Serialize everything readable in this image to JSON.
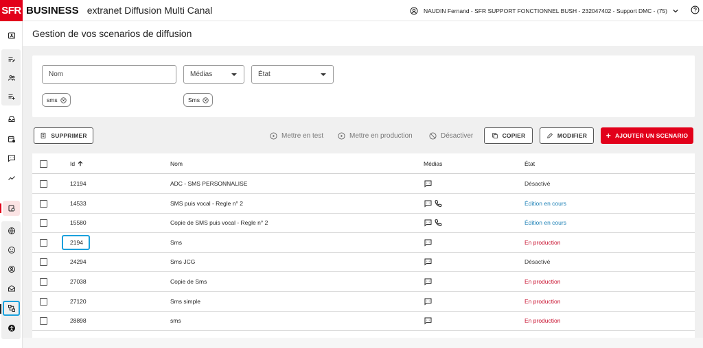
{
  "header": {
    "logo": "SFR",
    "brand": "BUSINESS",
    "app_title": "extranet Diffusion Multi Canal",
    "user": "NAUDIN Fernand - SFR SUPPORT FONCTIONNEL BUSH - 232047402 - Support DMC - (75)",
    "icons": [
      "user-circle-icon",
      "chevron-down-icon",
      "help-icon"
    ]
  },
  "sidebar": {
    "icons": [
      "contact-card-icon",
      "list-edit-icon",
      "users-icon",
      "playlist-add-icon",
      "inbox-icon",
      "calendar-clock-icon",
      "message-icon",
      "trending-icon",
      "scenario-active-icon",
      "globe-icon",
      "face-icon",
      "account-icon",
      "mailbox-icon",
      "flow-chart-icon",
      "accessibility-icon"
    ]
  },
  "page": {
    "title": "Gestion de vos scenarios de diffusion"
  },
  "filters": {
    "nom_placeholder": "Nom",
    "medias_label": "Médias",
    "etat_label": "État",
    "chips": [
      "sms",
      "Sms"
    ]
  },
  "toolbar": {
    "delete": "SUPPRIMER",
    "test": "Mettre en test",
    "production": "Mettre en production",
    "deactivate": "Désactiver",
    "copy": "COPIER",
    "edit": "MODIFIER",
    "add": "AJOUTER UN SCENARIO"
  },
  "table": {
    "columns": {
      "id": "Id",
      "nom": "Nom",
      "medias": "Médias",
      "etat": "État"
    },
    "rows": [
      {
        "id": "12194",
        "nom": "ADC - SMS PERSONNALISE",
        "medias": [
          "sms"
        ],
        "etat": "Désactivé",
        "status": "grey"
      },
      {
        "id": "14533",
        "nom": "SMS puis vocal - Regle n° 2",
        "medias": [
          "sms",
          "voice"
        ],
        "etat": "Édition en cours",
        "status": "blue"
      },
      {
        "id": "15580",
        "nom": "Copie de SMS puis vocal - Regle n° 2",
        "medias": [
          "sms",
          "voice"
        ],
        "etat": "Édition en cours",
        "status": "blue"
      },
      {
        "id": "2194",
        "nom": "Sms",
        "medias": [
          "sms"
        ],
        "etat": "En production",
        "status": "red"
      },
      {
        "id": "24294",
        "nom": "Sms JCG",
        "medias": [
          "sms"
        ],
        "etat": "Désactivé",
        "status": "grey"
      },
      {
        "id": "27038",
        "nom": "Copie de Sms",
        "medias": [
          "sms"
        ],
        "etat": "En production",
        "status": "red"
      },
      {
        "id": "27120",
        "nom": "Sms simple",
        "medias": [
          "sms"
        ],
        "etat": "En production",
        "status": "red"
      },
      {
        "id": "28898",
        "nom": "sms",
        "medias": [
          "sms"
        ],
        "etat": "En production",
        "status": "red"
      }
    ]
  },
  "colors": {
    "brand_red": "#e2001a",
    "status_red": "#c8102e",
    "status_blue": "#1a7fb5",
    "focus_blue": "#1aa0dc"
  }
}
